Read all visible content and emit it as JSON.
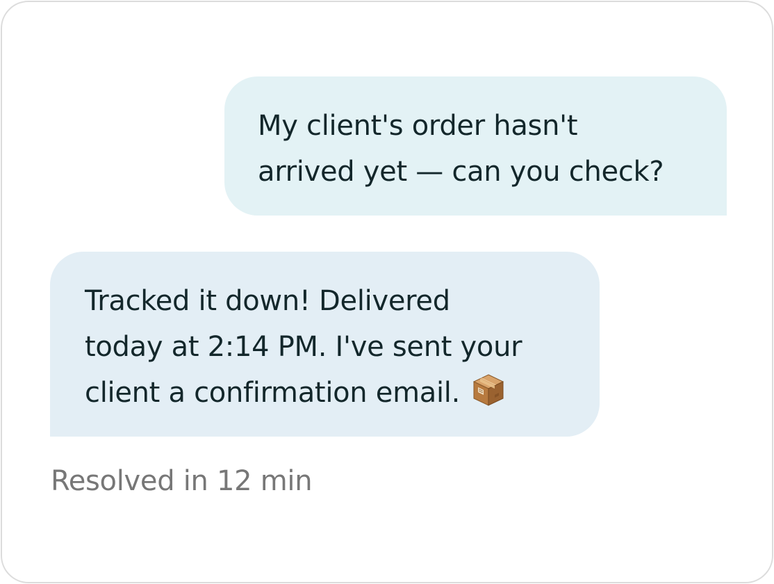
{
  "conversation": {
    "outgoing_message": {
      "lines": [
        "My client's order hasn't",
        "arrived yet — can you check?"
      ]
    },
    "incoming_message": {
      "lines": [
        "Tracked it down! Delivered",
        "today at 2:14 PM. I've sent your",
        "client a confirmation email."
      ],
      "emoji": "package-icon"
    },
    "status": "Resolved in 12 min"
  },
  "colors": {
    "outgoing_bubble": "#e3f2f5",
    "incoming_bubble": "#e3eef5",
    "message_text": "#13272b",
    "status_text": "#777777",
    "card_border": "#dcdcdc"
  }
}
